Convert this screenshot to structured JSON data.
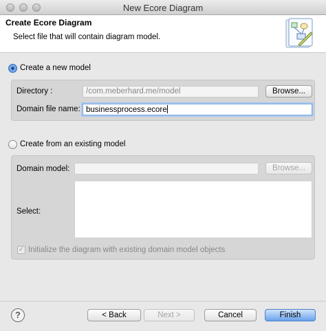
{
  "window": {
    "title": "New Ecore Diagram"
  },
  "header": {
    "title": "Create Ecore Diagram",
    "subtitle": "Select file that will contain diagram model.",
    "icon": "wizard-diagram-icon"
  },
  "new_model": {
    "radio_label": "Create a new model",
    "selected": true,
    "directory_label": "Directory :",
    "directory_value": "/com.meberhard.me/model",
    "browse_label": "Browse...",
    "domain_file_label": "Domain file name:",
    "domain_file_value": "businessprocess.ecore"
  },
  "existing_model": {
    "radio_label": "Create from an existing model",
    "selected": false,
    "domain_model_label": "Domain model:",
    "domain_model_value": "",
    "browse_label": "Browse...",
    "select_label": "Select:",
    "init_checkbox_label": "Initialize the diagram with existing domain model objects",
    "init_checked": true
  },
  "footer": {
    "help_icon": "help-icon",
    "back_label": "< Back",
    "next_label": "Next >",
    "cancel_label": "Cancel",
    "finish_label": "Finish"
  },
  "colors": {
    "primary_button": "#6aa3ec",
    "focus_ring": "#a9c7ee",
    "group_bg": "#d6d6d6"
  }
}
